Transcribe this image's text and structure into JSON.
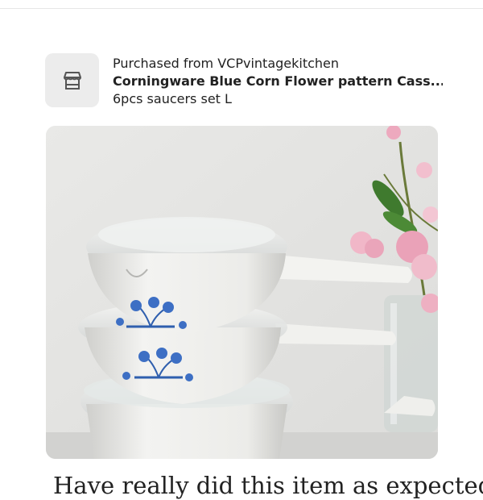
{
  "purchase": {
    "shop_line": "Purchased from VCPvintagekitchen",
    "item_title": "Corningware Blue Corn Flower pattern Cass...",
    "item_variant": "6pcs saucers set L",
    "shop_icon": "storefront-icon"
  },
  "photo": {
    "subject": "cookware-photo"
  },
  "review": {
    "text": "Have really did this item as expected"
  },
  "colors": {
    "thumb_bg": "#ececec",
    "text": "#222222",
    "cornflower_blue": "#3d6fc4"
  }
}
